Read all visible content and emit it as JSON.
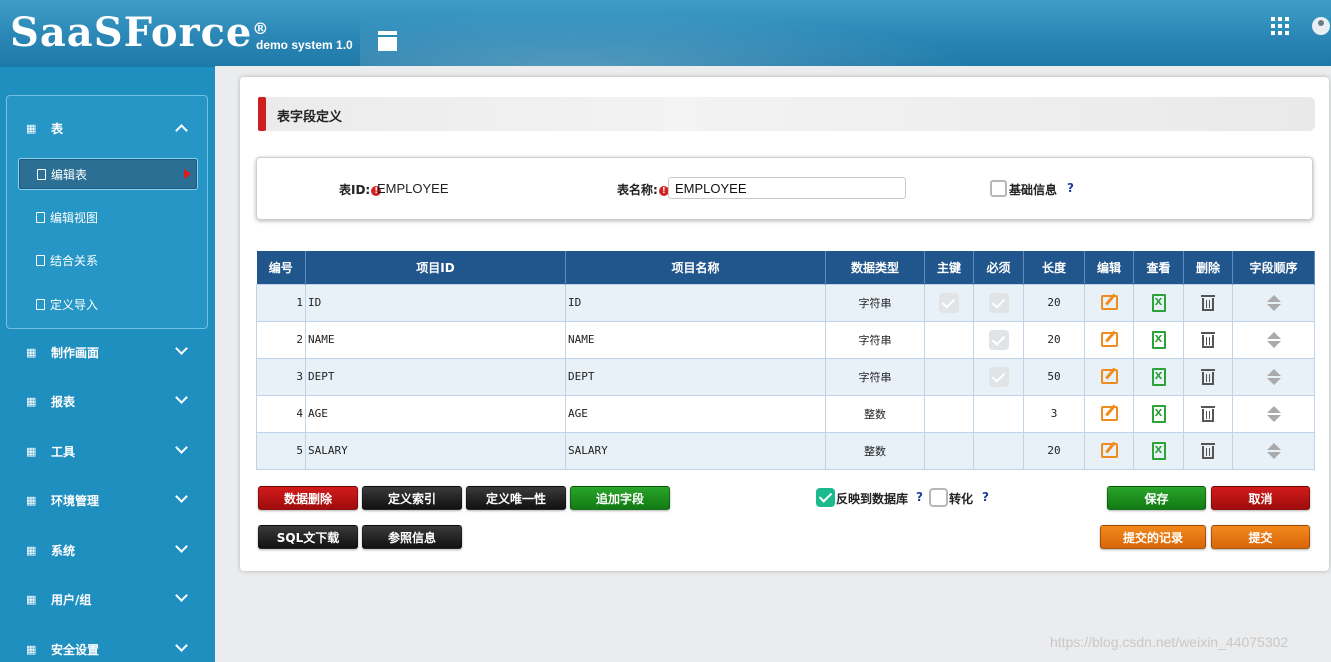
{
  "header": {
    "logo": "SaaSForce",
    "logo_mark": "®",
    "version": "demo system 1.0",
    "menu_toggle_icon": "menu-icon",
    "apps_icon": "grid-icon",
    "user_icon": "user-icon"
  },
  "sidebar": {
    "group_icon": "table-grid-icon",
    "items": [
      {
        "label": "表",
        "expanded": true
      },
      {
        "label": "制作画面"
      },
      {
        "label": "报表"
      },
      {
        "label": "工具"
      },
      {
        "label": "环境管理"
      },
      {
        "label": "系统"
      },
      {
        "label": "用户/组"
      },
      {
        "label": "安全设置"
      }
    ],
    "subitems": [
      {
        "label": "编辑表",
        "active": true
      },
      {
        "label": "编辑视图"
      },
      {
        "label": "结合关系"
      },
      {
        "label": "定义导入"
      }
    ]
  },
  "page": {
    "title": "表字段定义",
    "accent_color": "#cf1e1e"
  },
  "form": {
    "table_id_label": "表ID:",
    "table_id_value": "EMPLOYEE",
    "table_name_label": "表名称:",
    "table_name_value": "EMPLOYEE",
    "basic_info_label": "基础信息",
    "basic_info_checked": false,
    "help": "?"
  },
  "table": {
    "header_color": "#20568c",
    "columns": [
      "编号",
      "项目ID",
      "项目名称",
      "数据类型",
      "主键",
      "必须",
      "长度",
      "编辑",
      "查看",
      "删除",
      "字段顺序"
    ],
    "rows": [
      {
        "no": "1",
        "item_id": "ID",
        "item_name": "ID",
        "type": "字符串",
        "pk": true,
        "required": true,
        "length": "20"
      },
      {
        "no": "2",
        "item_id": "NAME",
        "item_name": "NAME",
        "type": "字符串",
        "pk": false,
        "required": true,
        "length": "20"
      },
      {
        "no": "3",
        "item_id": "DEPT",
        "item_name": "DEPT",
        "type": "字符串",
        "pk": false,
        "required": true,
        "length": "50"
      },
      {
        "no": "4",
        "item_id": "AGE",
        "item_name": "AGE",
        "type": "整数",
        "pk": false,
        "required": false,
        "length": "3"
      },
      {
        "no": "5",
        "item_id": "SALARY",
        "item_name": "SALARY",
        "type": "整数",
        "pk": false,
        "required": false,
        "length": "20"
      }
    ],
    "xls_glyph": "X"
  },
  "actions": {
    "delete_data": "数据删除",
    "define_index": "定义索引",
    "define_unique": "定义唯一性",
    "add_field": "追加字段",
    "sql_download": "SQL文下载",
    "reference_info": "参照信息",
    "reflect_db_label": "反映到数据库",
    "reflect_db_checked": true,
    "convert_label": "转化",
    "convert_checked": false,
    "save": "保存",
    "cancel": "取消",
    "submitted_records": "提交的记录",
    "submit": "提交"
  },
  "watermark": "https://blog.csdn.net/weixin_44075302"
}
